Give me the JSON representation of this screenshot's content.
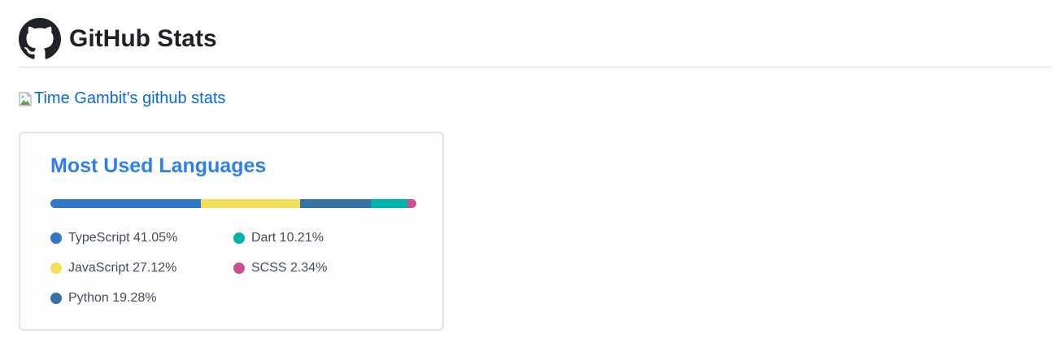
{
  "header": {
    "title": "GitHub Stats",
    "logo_icon": "github-octocat-icon"
  },
  "stats_image": {
    "alt_text": "Time Gambit's github stats",
    "icon": "broken-image-icon"
  },
  "languages_card": {
    "title": "Most Used Languages",
    "languages": [
      {
        "name": "TypeScript",
        "percent": 41.05,
        "label": "TypeScript 41.05%",
        "color": "#3178c6"
      },
      {
        "name": "JavaScript",
        "percent": 27.12,
        "label": "JavaScript 27.12%",
        "color": "#f1e05a"
      },
      {
        "name": "Python",
        "percent": 19.28,
        "label": "Python 19.28%",
        "color": "#3572a5"
      },
      {
        "name": "Dart",
        "percent": 10.21,
        "label": "Dart 10.21%",
        "color": "#00b4ab"
      },
      {
        "name": "SCSS",
        "percent": 2.34,
        "label": "SCSS 2.34%",
        "color": "#c6538c"
      }
    ]
  }
}
